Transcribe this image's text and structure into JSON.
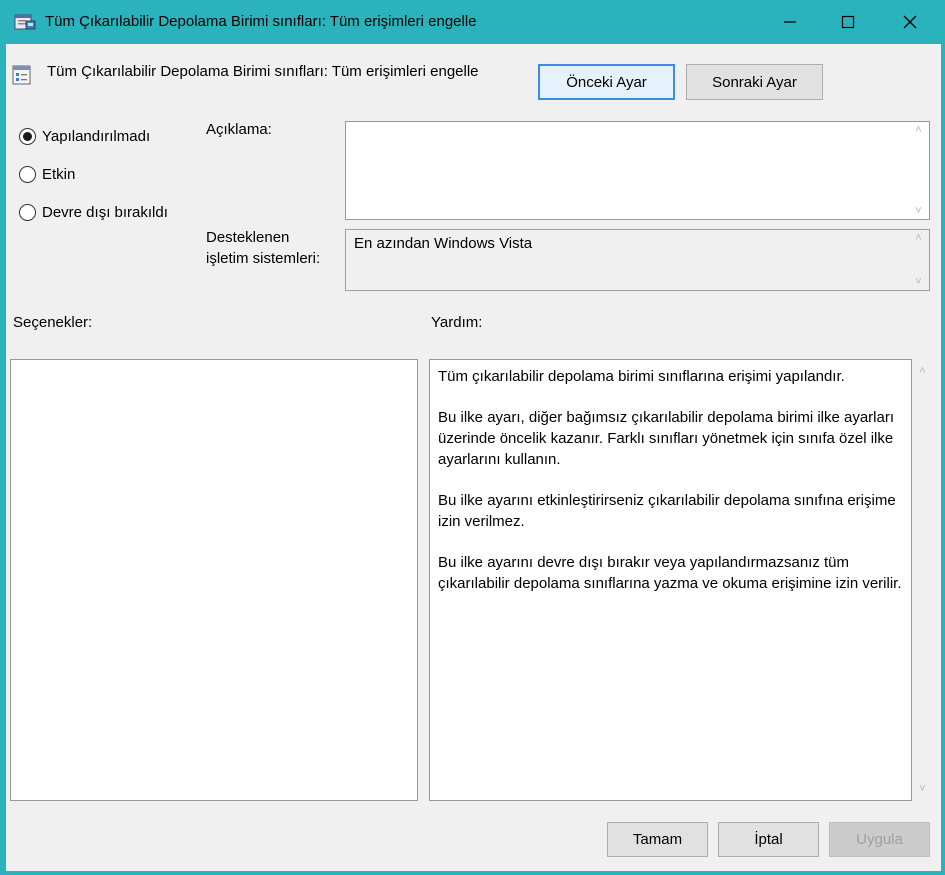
{
  "window": {
    "title": "Tüm Çıkarılabilir Depolama Birimi sınıfları: Tüm erişimleri engelle",
    "app_icon": "group-policy-icon",
    "controls": [
      "minimize-icon",
      "maximize-icon",
      "close-icon"
    ]
  },
  "header": {
    "setting_title": "Tüm Çıkarılabilir Depolama Birimi sınıfları: Tüm erişimleri engelle",
    "prev_button": "Önceki Ayar",
    "next_button": "Sonraki Ayar"
  },
  "state": {
    "options": [
      {
        "label": "Yapılandırılmadı",
        "checked": true
      },
      {
        "label": "Etkin",
        "checked": false
      },
      {
        "label": "Devre dışı bırakıldı",
        "checked": false
      }
    ]
  },
  "comment": {
    "label": "Açıklama:",
    "value": ""
  },
  "supported": {
    "label_line1": "Desteklenen",
    "label_line2": "işletim sistemleri:",
    "value": "En azından Windows Vista"
  },
  "panels": {
    "options_label": "Seçenekler:",
    "help_label": "Yardım:"
  },
  "help": {
    "paragraphs": [
      "Tüm çıkarılabilir depolama birimi sınıflarına erişimi yapılandır.",
      "Bu ilke ayarı, diğer bağımsız çıkarılabilir depolama birimi ilke ayarları üzerinde öncelik kazanır. Farklı sınıfları yönetmek için sınıfa özel ilke ayarlarını kullanın.",
      "Bu ilke ayarını etkinleştirirseniz çıkarılabilir depolama sınıfına erişime izin verilmez.",
      "Bu ilke ayarını devre dışı bırakır veya yapılandırmazsanız tüm çıkarılabilir depolama sınıflarına yazma ve okuma erişimine izin verilir."
    ]
  },
  "footer": {
    "ok": "Tamam",
    "cancel": "İptal",
    "apply": "Uygula"
  },
  "colors": {
    "titlebar": "#2bb3bd",
    "accent_button_border": "#3c8ce7"
  }
}
